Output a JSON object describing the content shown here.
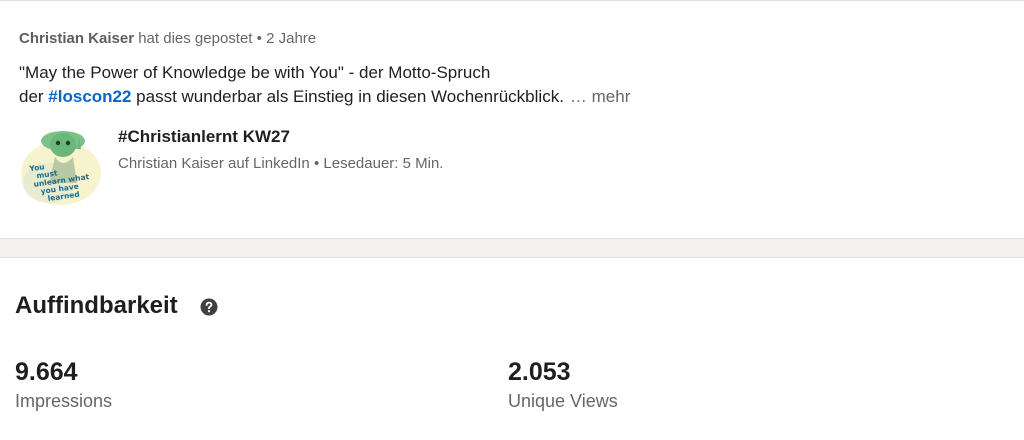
{
  "post": {
    "author": "Christian Kaiser",
    "action": "hat dies gepostet",
    "separator": "•",
    "time": "2 Jahre",
    "text_line1": "\"May the Power of Knowledge be with You\" - der Motto-Spruch",
    "text_prefix": "der ",
    "hashtag": "#loscon22",
    "text_suffix": " passt wunderbar als Einstieg in diesen Wochenrückblick.",
    "more_label": "… mehr"
  },
  "article": {
    "title": "#Christianlernt KW27",
    "source": "Christian Kaiser auf LinkedIn",
    "separator": "•",
    "read_time": "Lesedauer: 5 Min.",
    "thumb_text_lines": [
      "You",
      "must",
      "unlearn what",
      "you have",
      "learned"
    ]
  },
  "discoverability": {
    "title": "Auffindbarkeit",
    "help_icon": "question-circle-icon",
    "stats": [
      {
        "value": "9.664",
        "label": "Impressions"
      },
      {
        "value": "2.053",
        "label": "Unique Views"
      }
    ]
  },
  "colors": {
    "link": "#0a66c2",
    "muted": "#666666",
    "text": "#1f1f1f",
    "band": "#f4f2ee"
  }
}
